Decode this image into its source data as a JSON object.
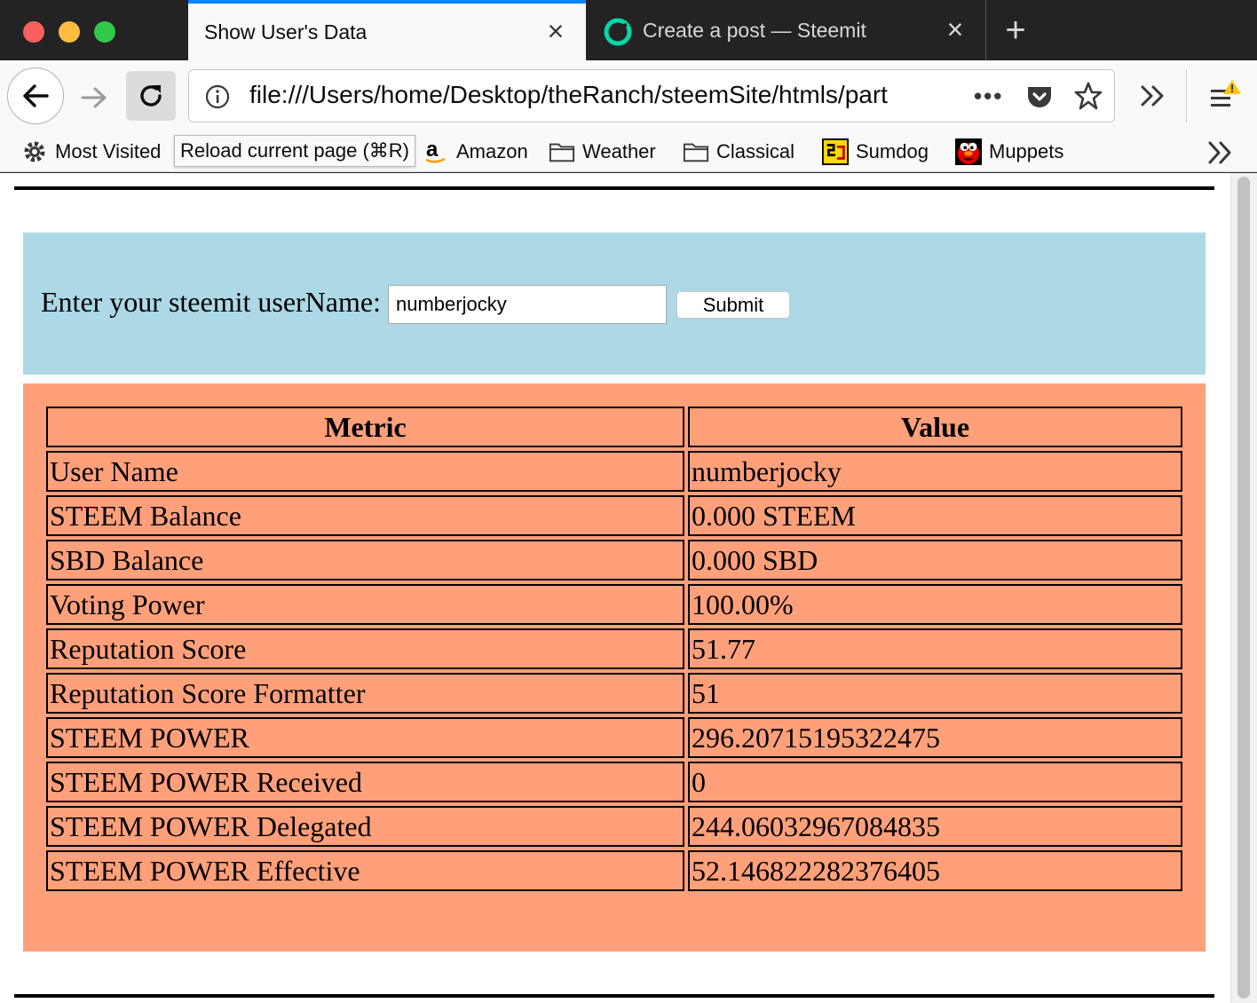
{
  "tabs": [
    {
      "title": "Show User's Data",
      "active": true
    },
    {
      "title": "Create a post — Steemit",
      "active": false
    }
  ],
  "navbar": {
    "url": "file:///Users/home/Desktop/theRanch/steemSite/htmls/part"
  },
  "tooltip": "Reload current page (⌘R)",
  "bookmarks": [
    {
      "label": "Most Visited",
      "icon": "gear-icon"
    },
    {
      "label": "Amazon",
      "icon": "amazon-icon"
    },
    {
      "label": "Weather",
      "icon": "folder-icon"
    },
    {
      "label": "Classical",
      "icon": "folder-icon"
    },
    {
      "label": "Sumdog",
      "icon": "sumdog-icon"
    },
    {
      "label": "Muppets",
      "icon": "muppets-icon"
    }
  ],
  "form": {
    "label": "Enter your steemit userName:",
    "input_value": "numberjocky",
    "submit_label": "Submit",
    "panel_color": "#add8e6"
  },
  "table": {
    "panel_color": "#ffa07a",
    "headers": {
      "metric": "Metric",
      "value": "Value"
    },
    "rows": [
      {
        "metric": "User Name",
        "value": "numberjocky"
      },
      {
        "metric": "STEEM Balance",
        "value": "0.000 STEEM"
      },
      {
        "metric": "SBD Balance",
        "value": "0.000 SBD"
      },
      {
        "metric": "Voting Power",
        "value": "100.00%"
      },
      {
        "metric": "Reputation Score",
        "value": "51.77"
      },
      {
        "metric": "Reputation Score Formatter",
        "value": "51"
      },
      {
        "metric": "STEEM POWER",
        "value": "296.20715195322475"
      },
      {
        "metric": "STEEM POWER Received",
        "value": "0"
      },
      {
        "metric": "STEEM POWER Delegated",
        "value": "244.06032967084835"
      },
      {
        "metric": "STEEM POWER Effective",
        "value": "52.146822282376405"
      }
    ]
  }
}
